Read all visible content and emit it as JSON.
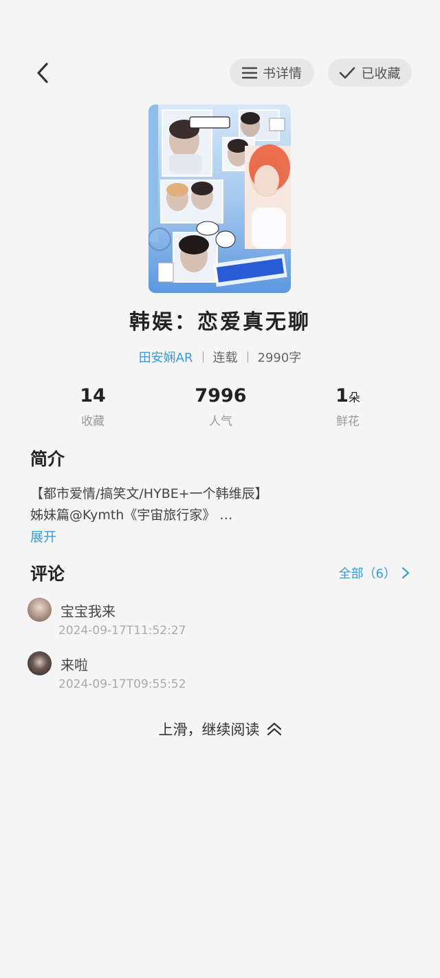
{
  "header": {
    "detail_label": "书详情",
    "favorite_label": "已收藏"
  },
  "book": {
    "title": "韩娱：恋爱真无聊",
    "author": "田安娴AR",
    "status": "连载",
    "word_count": "2990字"
  },
  "stats": [
    {
      "value": "14",
      "unit": "",
      "label": "收藏"
    },
    {
      "value": "7996",
      "unit": "",
      "label": "人气"
    },
    {
      "value": "1",
      "unit": "朵",
      "label": "鲜花"
    }
  ],
  "intro": {
    "title": "简介",
    "line1": "【都市爱情/搞笑文/HYBE+一个韩维辰】",
    "line2": "姊妹篇@Kymth《宇宙旅行家》 …",
    "expand_label": "展开"
  },
  "comments": {
    "title": "评论",
    "view_all_label": "全部（6）",
    "items": [
      {
        "name": "宝宝我来",
        "time": "2024-09-17T11:52:27"
      },
      {
        "name": "来啦",
        "time": "2024-09-17T09:55:52"
      }
    ]
  },
  "footer": {
    "continue_label": "上滑，继续阅读"
  },
  "colors": {
    "accent": "#3a9bd9",
    "background": "#f5f5f5",
    "pill_background": "#e8e8e8"
  },
  "icons": {
    "back": "chevron-left-icon",
    "detail": "menu-lines-icon",
    "favorite": "check-icon",
    "view_all": "chevron-right-icon",
    "continue": "double-chevron-up-icon"
  }
}
